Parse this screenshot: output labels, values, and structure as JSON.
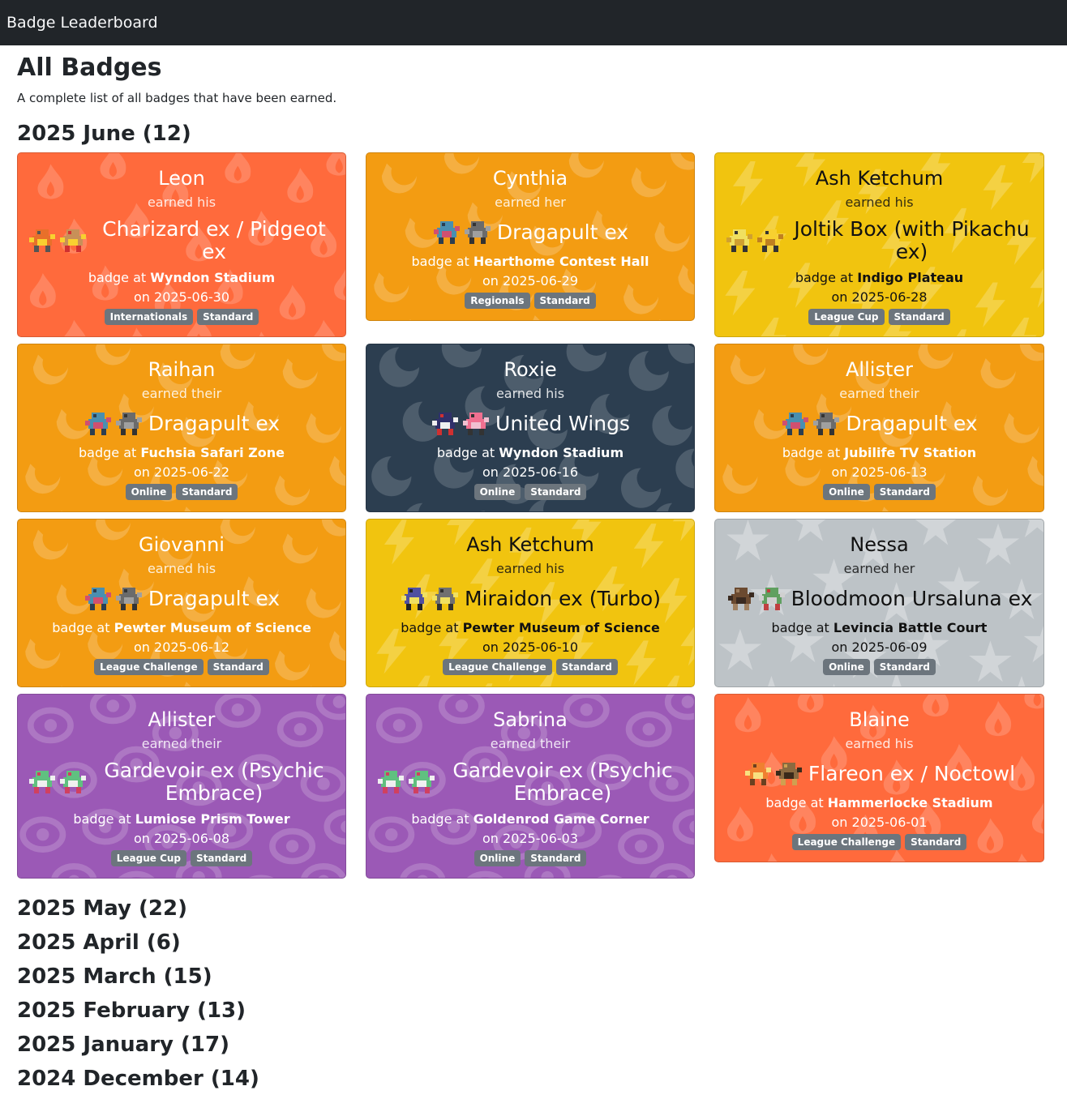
{
  "nav": {
    "brand": "Badge Leaderboard"
  },
  "page": {
    "title": "All Badges",
    "description": "A complete list of all badges that have been earned."
  },
  "current_month": {
    "title": "2025 June (12)",
    "badges": [
      {
        "trainer": "Leon",
        "earned": "earned his",
        "deck": "Charizard ex / Pidgeot ex",
        "badge_at": "badge at ",
        "venue": "Wyndon Stadium",
        "date": "on 2025-06-30",
        "tags": [
          "Internationals",
          "Standard"
        ],
        "theme": "fire",
        "sprites": [
          "charizard-icon",
          "pidgeot-icon"
        ]
      },
      {
        "trainer": "Cynthia",
        "earned": "earned her",
        "deck": "Dragapult ex",
        "badge_at": "badge at ",
        "venue": "Hearthome Contest Hall",
        "date": "on 2025-06-29",
        "tags": [
          "Regionals",
          "Standard"
        ],
        "theme": "dragon",
        "sprites": [
          "dragapult-icon",
          "dusknoir-icon"
        ]
      },
      {
        "trainer": "Ash Ketchum",
        "earned": "earned his",
        "deck": "Joltik Box (with Pikachu ex)",
        "badge_at": "badge at ",
        "venue": "Indigo Plateau",
        "date": "on 2025-06-28",
        "tags": [
          "League Cup",
          "Standard"
        ],
        "theme": "electric",
        "sprites": [
          "joltik-icon",
          "pikachu-icon"
        ]
      },
      {
        "trainer": "Raihan",
        "earned": "earned their",
        "deck": "Dragapult ex",
        "badge_at": "badge at ",
        "venue": "Fuchsia Safari Zone",
        "date": "on 2025-06-22",
        "tags": [
          "Online",
          "Standard"
        ],
        "theme": "dragon",
        "sprites": [
          "dragapult-icon",
          "dusknoir-icon"
        ]
      },
      {
        "trainer": "Roxie",
        "earned": "earned his",
        "deck": "United Wings",
        "badge_at": "badge at ",
        "venue": "Wyndon Stadium",
        "date": "on 2025-06-16",
        "tags": [
          "Online",
          "Standard"
        ],
        "theme": "dark",
        "sprites": [
          "murkrow-icon",
          "flamigo-icon"
        ]
      },
      {
        "trainer": "Allister",
        "earned": "earned their",
        "deck": "Dragapult ex",
        "badge_at": "badge at ",
        "venue": "Jubilife TV Station",
        "date": "on 2025-06-13",
        "tags": [
          "Online",
          "Standard"
        ],
        "theme": "dragon",
        "sprites": [
          "dragapult-icon",
          "dusknoir-icon"
        ]
      },
      {
        "trainer": "Giovanni",
        "earned": "earned his",
        "deck": "Dragapult ex",
        "badge_at": "badge at ",
        "venue": "Pewter Museum of Science",
        "date": "on 2025-06-12",
        "tags": [
          "League Challenge",
          "Standard"
        ],
        "theme": "dragon",
        "sprites": [
          "dragapult-icon",
          "dusknoir-icon"
        ]
      },
      {
        "trainer": "Ash Ketchum",
        "earned": "earned his",
        "deck": "Miraidon ex (Turbo)",
        "badge_at": "badge at ",
        "venue": "Pewter Museum of Science",
        "date": "on 2025-06-10",
        "tags": [
          "League Challenge",
          "Standard"
        ],
        "theme": "electric",
        "sprites": [
          "miraidon-icon",
          "iron-hands-icon"
        ]
      },
      {
        "trainer": "Nessa",
        "earned": "earned her",
        "deck": "Bloodmoon Ursaluna ex",
        "badge_at": "badge at ",
        "venue": "Levincia Battle Court",
        "date": "on 2025-06-09",
        "tags": [
          "Online",
          "Standard"
        ],
        "theme": "colorless",
        "sprites": [
          "ursaluna-icon",
          "gallade-icon"
        ]
      },
      {
        "trainer": "Allister",
        "earned": "earned their",
        "deck": "Gardevoir ex (Psychic Embrace)",
        "badge_at": "badge at ",
        "venue": "Lumiose Prism Tower",
        "date": "on 2025-06-08",
        "tags": [
          "League Cup",
          "Standard"
        ],
        "theme": "psychic",
        "sprites": [
          "gardevoir-icon",
          "kirlia-icon"
        ]
      },
      {
        "trainer": "Sabrina",
        "earned": "earned their",
        "deck": "Gardevoir ex (Psychic Embrace)",
        "badge_at": "badge at ",
        "venue": "Goldenrod Game Corner",
        "date": "on 2025-06-03",
        "tags": [
          "Online",
          "Standard"
        ],
        "theme": "psychic",
        "sprites": [
          "gardevoir-icon",
          "kirlia-icon"
        ]
      },
      {
        "trainer": "Blaine",
        "earned": "earned his",
        "deck": "Flareon ex / Noctowl",
        "badge_at": "badge at ",
        "venue": "Hammerlocke Stadium",
        "date": "on 2025-06-01",
        "tags": [
          "League Challenge",
          "Standard"
        ],
        "theme": "fire",
        "sprites": [
          "flareon-icon",
          "noctowl-icon"
        ]
      }
    ]
  },
  "other_months": [
    "2025 May (22)",
    "2025 April (6)",
    "2025 March (15)",
    "2025 February (13)",
    "2025 January (17)",
    "2024 December (14)"
  ],
  "colors": {
    "fire": "#ff6a3c",
    "dragon": "#f39c12",
    "electric": "#f1c40f",
    "dark": "#2c3e50",
    "psychic": "#9b59b6",
    "colorless": "#bdc3c7",
    "tag": "#6c757d",
    "navbar": "#212529"
  }
}
